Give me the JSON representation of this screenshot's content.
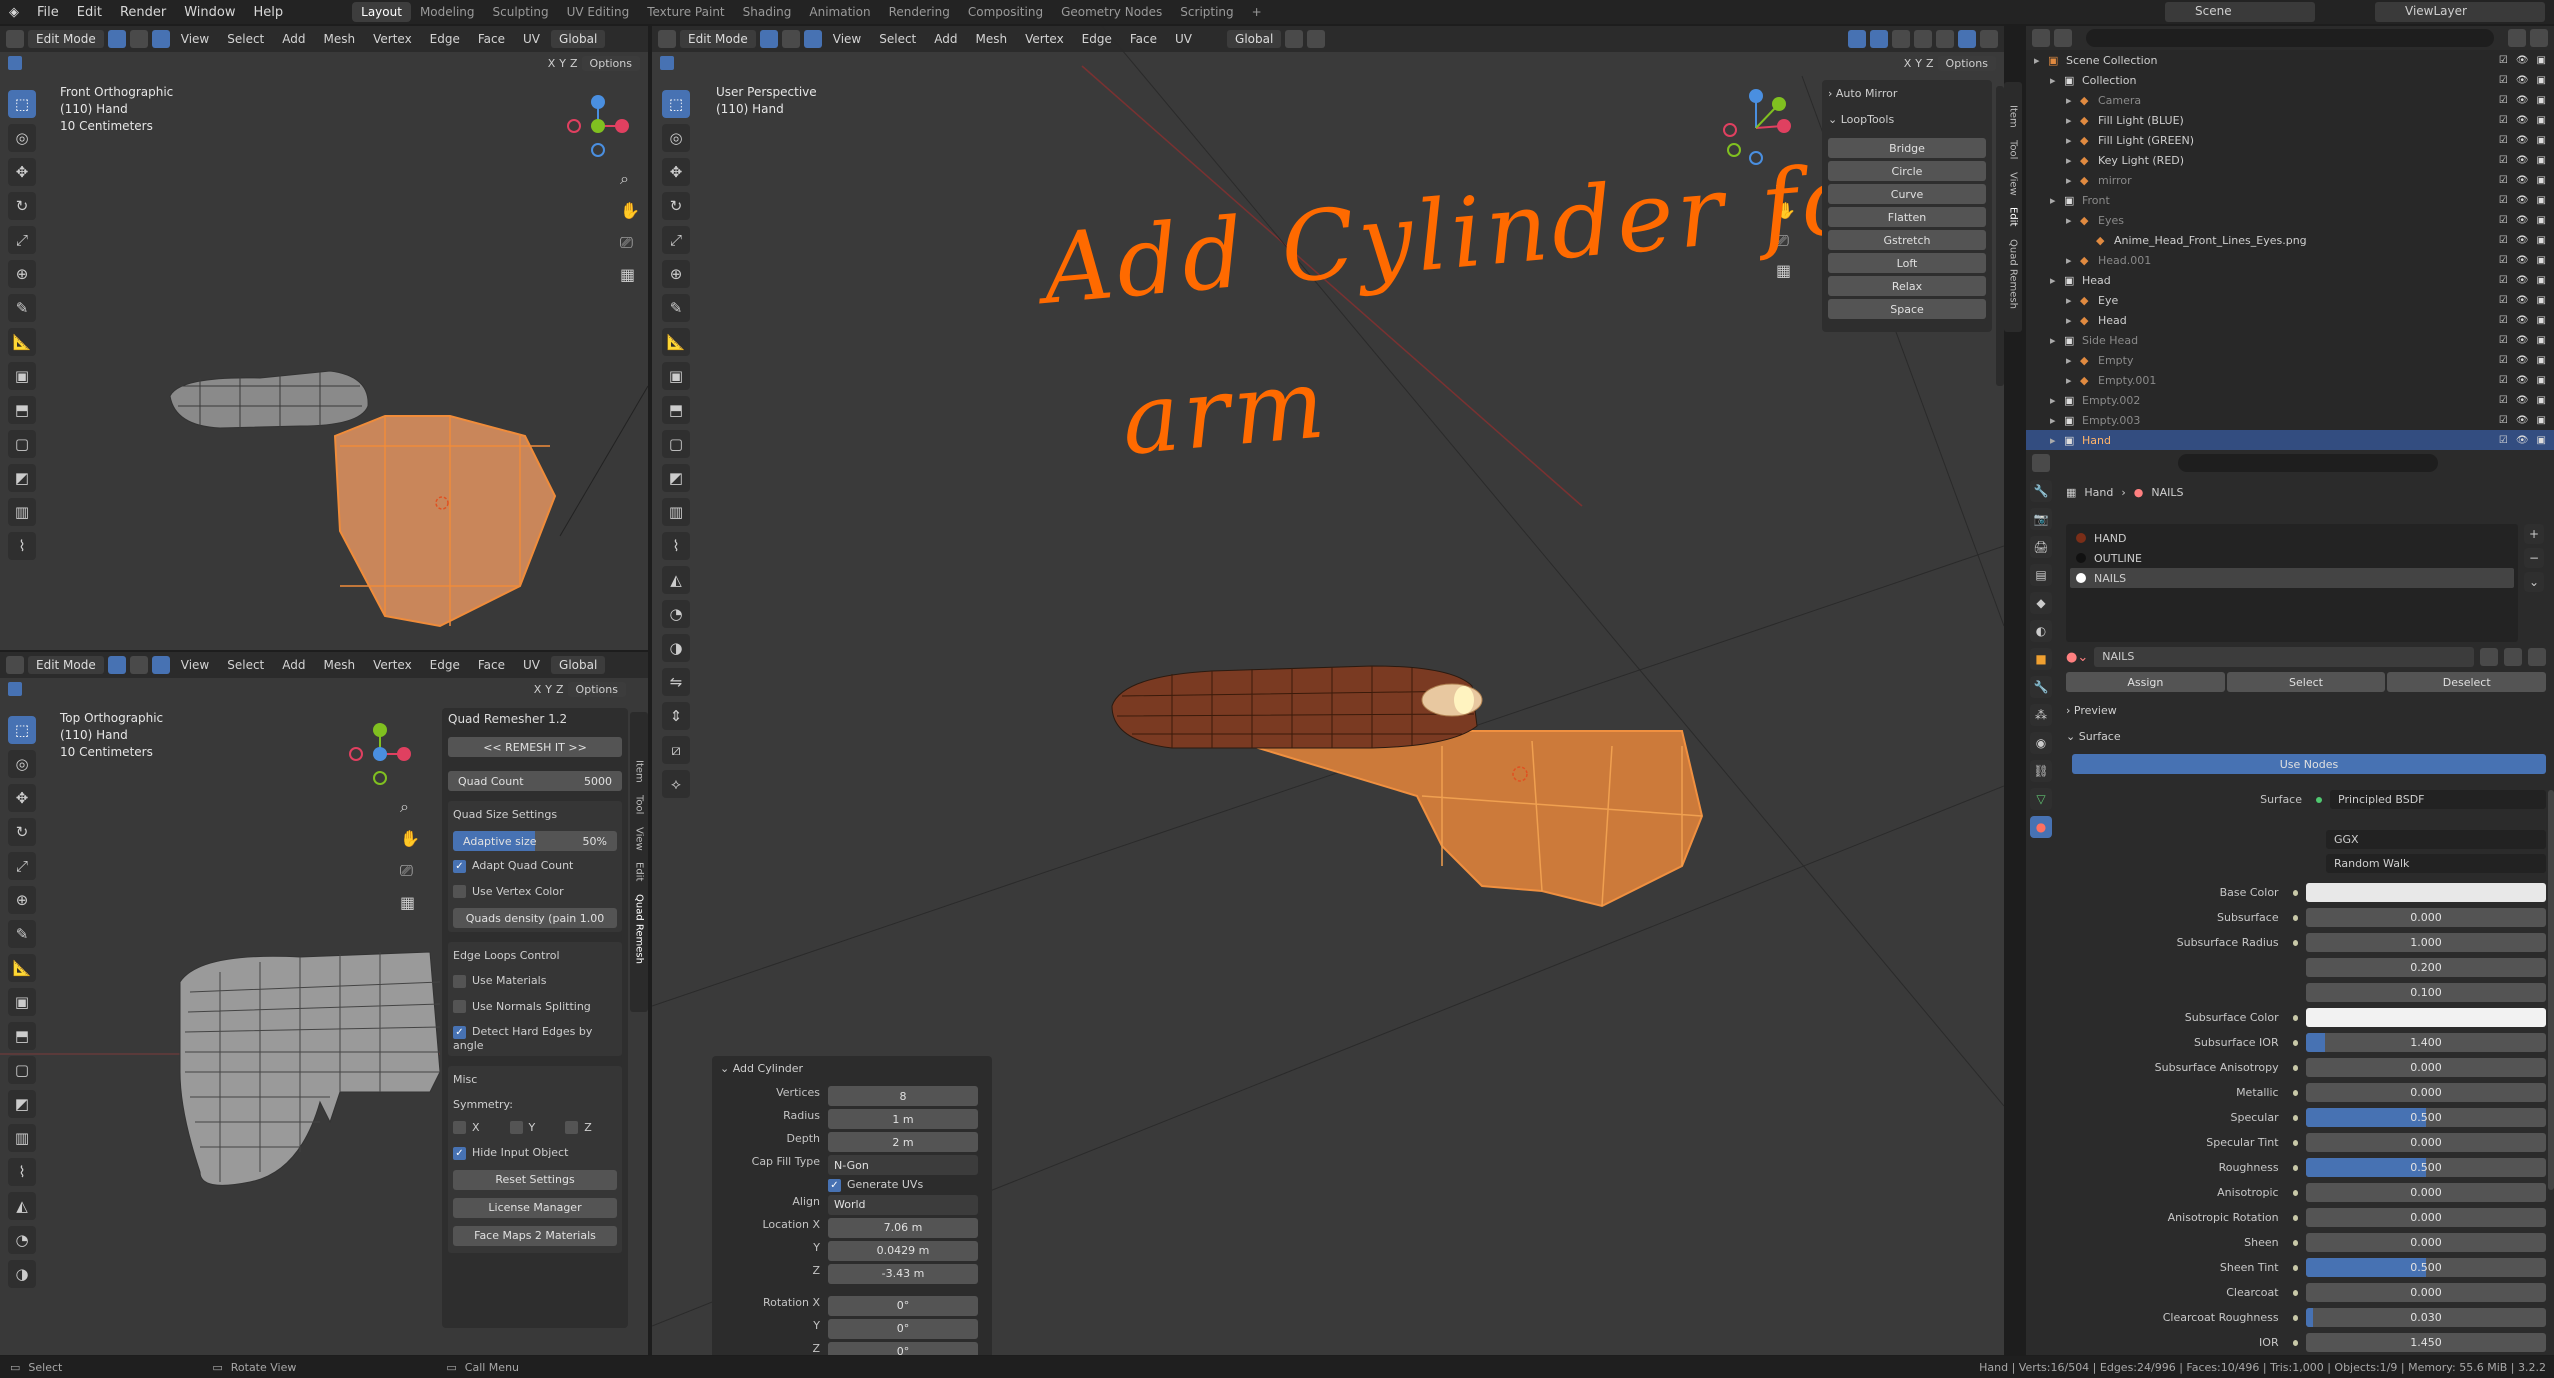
{
  "menu": [
    "File",
    "Edit",
    "Render",
    "Window",
    "Help"
  ],
  "workspaces": [
    "Layout",
    "Modeling",
    "Sculpting",
    "UV Editing",
    "Texture Paint",
    "Shading",
    "Animation",
    "Rendering",
    "Compositing",
    "Geometry Nodes",
    "Scripting",
    "+"
  ],
  "scene": "Scene",
  "view_layer": "ViewLayer",
  "vp_menu": [
    "View",
    "Select",
    "Add",
    "Mesh",
    "Vertex",
    "Edge",
    "Face",
    "UV"
  ],
  "edit_mode": "Edit Mode",
  "transform": "Global",
  "options": "Options",
  "xyz": [
    "X",
    "Y",
    "Z"
  ],
  "front_vp": {
    "l1": "Front Orthographic",
    "l2": "(110) Hand",
    "l3": "10 Centimeters"
  },
  "top_vp": {
    "l1": "Top Orthographic",
    "l2": "(110) Hand",
    "l3": "10 Centimeters"
  },
  "main_vp": {
    "l1": "User Perspective",
    "l2": "(110) Hand"
  },
  "annotation": {
    "line1": "Add Cylinder for",
    "line2": "arm"
  },
  "auto_mirror": "Auto Mirror",
  "looptools": {
    "title": "LoopTools",
    "items": [
      "Bridge",
      "Circle",
      "Curve",
      "Flatten",
      "Gstretch",
      "Loft",
      "Relax",
      "Space"
    ]
  },
  "side_tabs_main": [
    "Item",
    "Tool",
    "View",
    "Edit",
    "Quad Remesh"
  ],
  "side_tabs_top": [
    "Item",
    "Tool",
    "View",
    "Edit",
    "Quad Remesh"
  ],
  "quad": {
    "title": "Quad Remesher 1.2",
    "remesh": "<< REMESH IT >>",
    "quad_count_label": "Quad Count",
    "quad_count": "5000",
    "size_settings": "Quad Size Settings",
    "adaptive": "Adaptive size",
    "adaptive_val": "50%",
    "adaptive_pct": 0.5,
    "adapt_count": "Adapt Quad Count",
    "vertex_color": "Use Vertex Color",
    "density": "Quads density (pain",
    "density_val": "1.00",
    "edge_loops": "Edge Loops Control",
    "materials": "Use Materials",
    "normals": "Use Normals Splitting",
    "hard_edges": "Detect Hard Edges by angle",
    "misc": "Misc",
    "symmetry": "Symmetry:",
    "sym": [
      "X",
      "Y",
      "Z"
    ],
    "hide_input": "Hide Input Object",
    "reset": "Reset Settings",
    "license": "License Manager",
    "facemaps": "Face Maps 2 Materials"
  },
  "add_cyl": {
    "title": "Add Cylinder",
    "rows": [
      {
        "l": "Vertices",
        "v": "8"
      },
      {
        "l": "Radius",
        "v": "1 m"
      },
      {
        "l": "Depth",
        "v": "2 m"
      },
      {
        "l": "Cap Fill Type",
        "v": "N-Gon"
      }
    ],
    "gen_uv": "Generate UVs",
    "align_l": "Align",
    "align_v": "World",
    "loc": [
      {
        "l": "Location X",
        "v": "7.06 m"
      },
      {
        "l": "Y",
        "v": "0.0429 m"
      },
      {
        "l": "Z",
        "v": "-3.43 m"
      }
    ],
    "rot": [
      {
        "l": "Rotation X",
        "v": "0°"
      },
      {
        "l": "Y",
        "v": "0°"
      },
      {
        "l": "Z",
        "v": "0°"
      }
    ]
  },
  "outliner": {
    "rows": [
      {
        "t": "Scene Collection",
        "d": 0,
        "c": "#cfcfcf"
      },
      {
        "t": "Collection",
        "d": 1,
        "c": "#cfcfcf"
      },
      {
        "t": "Camera",
        "d": 2,
        "c": "#8a8a8a"
      },
      {
        "t": "Fill Light (BLUE)",
        "d": 2,
        "c": "#cfcfcf"
      },
      {
        "t": "Fill Light (GREEN)",
        "d": 2,
        "c": "#cfcfcf"
      },
      {
        "t": "Key Light (RED)",
        "d": 2,
        "c": "#cfcfcf"
      },
      {
        "t": "mirror",
        "d": 2,
        "c": "#8a8a8a"
      },
      {
        "t": "Front",
        "d": 1,
        "c": "#8a8a8a"
      },
      {
        "t": "Eyes",
        "d": 2,
        "c": "#8a8a8a"
      },
      {
        "t": "Anime_Head_Front_Lines_Eyes.png",
        "d": 3,
        "c": "#cfcfcf"
      },
      {
        "t": "Head.001",
        "d": 2,
        "c": "#8a8a8a"
      },
      {
        "t": "Head",
        "d": 1,
        "c": "#cfcfcf"
      },
      {
        "t": "Eye",
        "d": 2,
        "c": "#cfcfcf"
      },
      {
        "t": "Head",
        "d": 2,
        "c": "#cfcfcf"
      },
      {
        "t": "Side Head",
        "d": 1,
        "c": "#8a8a8a"
      },
      {
        "t": "Empty",
        "d": 2,
        "c": "#8a8a8a"
      },
      {
        "t": "Empty.001",
        "d": 2,
        "c": "#8a8a8a"
      },
      {
        "t": "Empty.002",
        "d": 1,
        "c": "#8a8a8a"
      },
      {
        "t": "Empty.003",
        "d": 1,
        "c": "#8a8a8a"
      },
      {
        "t": "Hand",
        "d": 1,
        "c": "#ffb469",
        "sel": true
      }
    ]
  },
  "props": {
    "crumb_obj": "Hand",
    "crumb_mat": "NAILS",
    "slots": [
      "HAND",
      "OUTLINE",
      "NAILS"
    ],
    "slot_colors": [
      "#7a2e18",
      "#111111",
      "#ffffff"
    ],
    "mat_name": "NAILS",
    "assign": "Assign",
    "select": "Select",
    "deselect": "Deselect",
    "preview": "Preview",
    "surface_hdr": "Surface",
    "use_nodes": "Use Nodes",
    "surface_l": "Surface",
    "surface_v": "Principled BSDF",
    "dist": "GGX",
    "sss_method": "Random Walk",
    "rows": [
      {
        "l": "Base Color",
        "color": "#e8e8e8"
      },
      {
        "l": "Subsurface",
        "v": "0.000",
        "f": 0
      },
      {
        "l": "Subsurface Radius",
        "v": "1.000",
        "f": 0
      },
      {
        "l": "",
        "v": "0.200",
        "f": 0
      },
      {
        "l": "",
        "v": "0.100",
        "f": 0
      },
      {
        "l": "Subsurface Color",
        "color": "#f2f2f2"
      },
      {
        "l": "Subsurface IOR",
        "v": "1.400",
        "f": 0.08
      },
      {
        "l": "Subsurface Anisotropy",
        "v": "0.000",
        "f": 0
      },
      {
        "l": "Metallic",
        "v": "0.000",
        "f": 0
      },
      {
        "l": "Specular",
        "v": "0.500",
        "f": 0.5
      },
      {
        "l": "Specular Tint",
        "v": "0.000",
        "f": 0
      },
      {
        "l": "Roughness",
        "v": "0.500",
        "f": 0.5
      },
      {
        "l": "Anisotropic",
        "v": "0.000",
        "f": 0
      },
      {
        "l": "Anisotropic Rotation",
        "v": "0.000",
        "f": 0
      },
      {
        "l": "Sheen",
        "v": "0.000",
        "f": 0
      },
      {
        "l": "Sheen Tint",
        "v": "0.500",
        "f": 0.5
      },
      {
        "l": "Clearcoat",
        "v": "0.000",
        "f": 0
      },
      {
        "l": "Clearcoat Roughness",
        "v": "0.030",
        "f": 0.03
      },
      {
        "l": "IOR",
        "v": "1.450",
        "f": 0
      }
    ]
  },
  "status": {
    "select": "Select",
    "rotate": "Rotate View",
    "menu": "Call Menu",
    "stats": "Hand | Verts:16/504 | Edges:24/996 | Faces:10/496 | Tris:1,000 | Objects:1/9 | Memory: 55.6 MiB | 3.2.2"
  },
  "colors": {
    "accent": "#4772b3",
    "orange": "#ff6a00",
    "mesh": "#e0884a"
  }
}
